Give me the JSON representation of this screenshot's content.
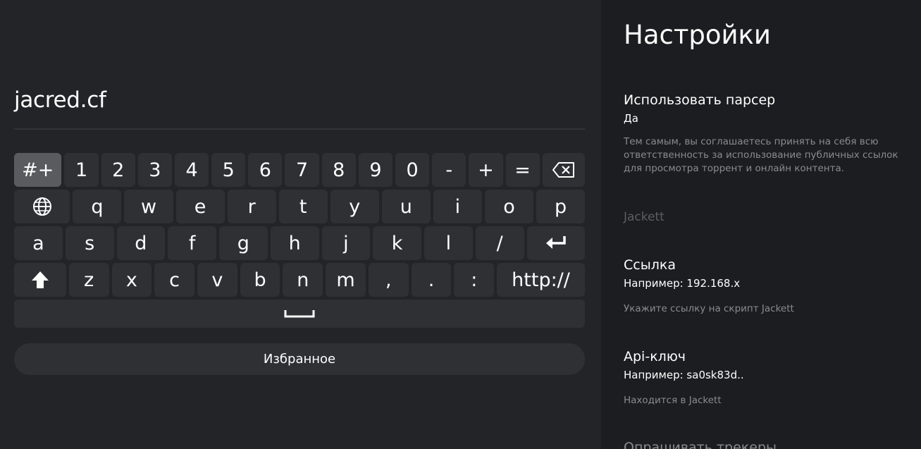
{
  "input": {
    "value": "jacred.cf"
  },
  "keyboard": {
    "row1": [
      "#+",
      "1",
      "2",
      "3",
      "4",
      "5",
      "6",
      "7",
      "8",
      "9",
      "0",
      "-",
      "+",
      "="
    ],
    "row2": [
      "q",
      "w",
      "e",
      "r",
      "t",
      "y",
      "u",
      "i",
      "o",
      "p"
    ],
    "row3": [
      "a",
      "s",
      "d",
      "f",
      "g",
      "h",
      "j",
      "k",
      "l",
      "/"
    ],
    "row4": [
      "z",
      "x",
      "c",
      "v",
      "b",
      "n",
      "m",
      ",",
      ".",
      ":",
      "http://"
    ],
    "selected": "#+"
  },
  "favorites_button": "Избранное",
  "settings": {
    "title": "Настройки",
    "parser": {
      "name": "Использовать парсер",
      "value": "Да",
      "description": "Тем самым, вы соглашаетесь принять на себя всю ответственность за использование публичных ссылок для просмотра торрент и онлайн контента."
    },
    "section_jackett": "Jackett",
    "link": {
      "name": "Ссылка",
      "value": "Например: 192.168.x",
      "description": "Укажите ссылку на скрипт Jackett"
    },
    "apikey": {
      "name": "Api-ключ",
      "value": "Например: sa0sk83d..",
      "description": "Находится в Jackett"
    },
    "next_item": "Опрашивать трекеры"
  }
}
